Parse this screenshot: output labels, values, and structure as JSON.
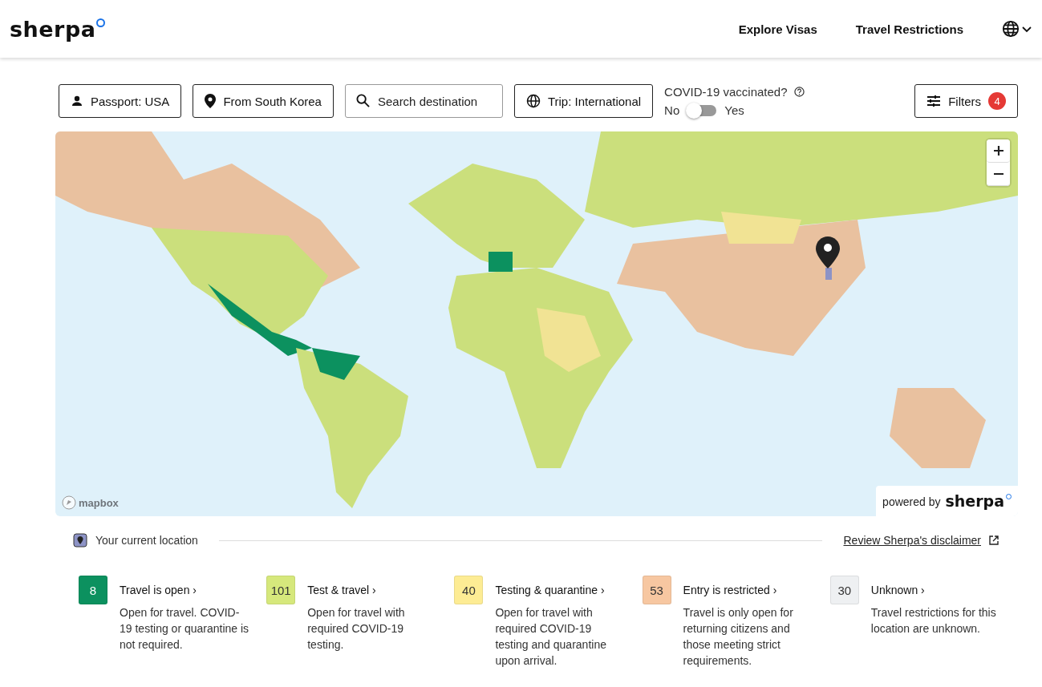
{
  "header": {
    "logo": "sherpa",
    "nav": [
      "Explore Visas",
      "Travel Restrictions"
    ]
  },
  "controls": {
    "passport": "Passport: USA",
    "origin": "From South Korea",
    "search": {
      "placeholder": "Search destination"
    },
    "trip": "Trip: International",
    "vaccinated": {
      "label": "COVID-19 vaccinated?",
      "off_label": "No",
      "on_label": "Yes",
      "on": false
    },
    "filters": {
      "label": "Filters",
      "count": "4"
    }
  },
  "map": {
    "kind": "picture",
    "attribution": "mapbox",
    "powered_by": "powered by",
    "powered_logo": "sherpa"
  },
  "location_legend": {
    "label": "Your current location",
    "disclaimer": "Review Sherpa's disclaimer"
  },
  "legend": [
    {
      "count": "8",
      "title": "Travel is open ›",
      "description": "Open for travel. COVID-19 testing or quarantine is not required.",
      "color": "#0c915f"
    },
    {
      "count": "101",
      "title": "Test & travel ›",
      "description": "Open for travel with required COVID-19 testing.",
      "color": "#d6e87c"
    },
    {
      "count": "40",
      "title": "Testing & quarantine ›",
      "description": "Open for travel with required COVID-19 testing and quarantine upon arrival.",
      "color": "#fdec94"
    },
    {
      "count": "53",
      "title": "Entry is restricted ›",
      "description": "Travel is only open for returning citizens and those meeting strict requirements.",
      "color": "#f7c7a1"
    },
    {
      "count": "30",
      "title": "Unknown ›",
      "description": "Travel restrictions for this location are unknown.",
      "color": "#eef0f2"
    }
  ]
}
